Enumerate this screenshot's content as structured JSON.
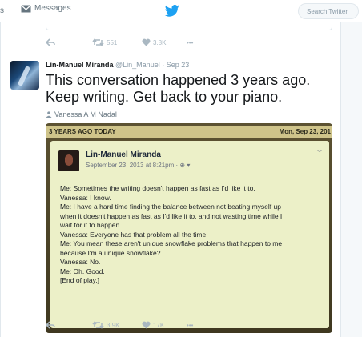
{
  "nav": {
    "left_fragment": "s",
    "messages_label": "Messages",
    "search_placeholder": "Search Twitter"
  },
  "previous_tweet": {
    "retweets": "551",
    "likes": "3.8K",
    "more": "•••"
  },
  "tweet": {
    "author_name": "Lin-Manuel Miranda",
    "author_handle": "@Lin_Manuel",
    "separator": "·",
    "time": "Sep 23",
    "text_line1": "This conversation happened 3 years ago.",
    "text_line2": "Keep writing. Get back to your piano.",
    "tagged_user": "Vanessa A M Nadal",
    "retweets": "3.9K",
    "likes": "17K",
    "more": "•••"
  },
  "photo": {
    "banner_left": "3 YEARS AGO TODAY",
    "banner_right": "Mon, Sep 23, 201",
    "card_name": "Lin-Manuel Miranda",
    "card_meta": "September 23, 2013 at 8:21pm · ⊕ ▾",
    "lines": [
      "Me: Sometimes the writing doesn't happen as fast as I'd like it to.",
      "Vanessa: I know.",
      "Me: I have a hard time finding the balance between not beating myself up",
      "when it doesn't happen as fast as I'd like it to, and not wasting time while I",
      "wait for it to happen.",
      "Vanessa: Everyone has that problem all the time.",
      "Me: You mean these aren't unique snowflake problems that happen to me",
      "because I'm a unique snowflake?",
      "Vanessa: No.",
      "Me: Oh. Good.",
      "[End of play.]"
    ]
  },
  "colors": {
    "twitter_blue": "#1da1f2",
    "icon_gray": "#aab8c2"
  },
  "icons": [
    "envelope-icon",
    "twitter-bird-icon",
    "reply-icon",
    "retweet-icon",
    "heart-icon",
    "more-icon",
    "person-icon",
    "chevron-down-icon"
  ]
}
